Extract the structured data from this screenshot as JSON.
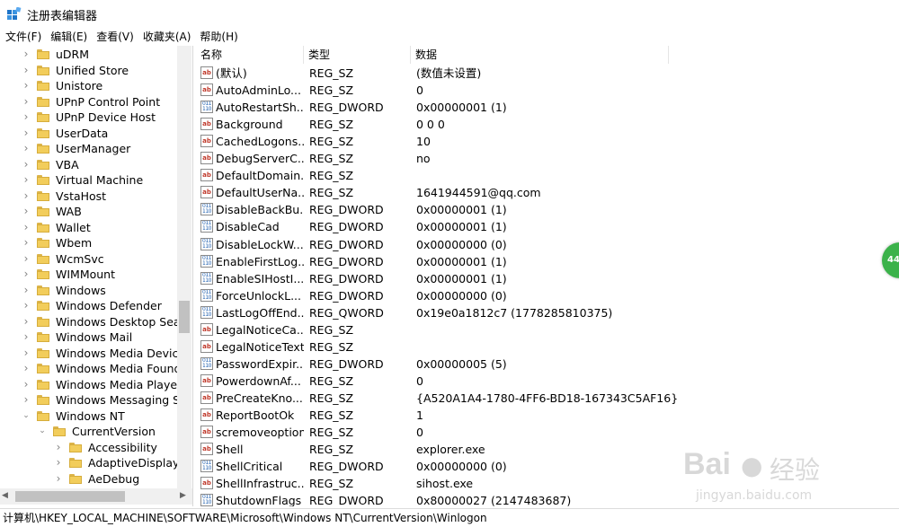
{
  "window": {
    "title": "注册表编辑器"
  },
  "menu": [
    "文件(F)",
    "编辑(E)",
    "查看(V)",
    "收藏夹(A)",
    "帮助(H)"
  ],
  "tree": {
    "items": [
      {
        "label": "uDRM",
        "depth": 0,
        "state": "collapsed"
      },
      {
        "label": "Unified Store",
        "depth": 0,
        "state": "collapsed"
      },
      {
        "label": "Unistore",
        "depth": 0,
        "state": "collapsed"
      },
      {
        "label": "UPnP Control Point",
        "depth": 0,
        "state": "collapsed"
      },
      {
        "label": "UPnP Device Host",
        "depth": 0,
        "state": "collapsed"
      },
      {
        "label": "UserData",
        "depth": 0,
        "state": "collapsed"
      },
      {
        "label": "UserManager",
        "depth": 0,
        "state": "collapsed"
      },
      {
        "label": "VBA",
        "depth": 0,
        "state": "collapsed"
      },
      {
        "label": "Virtual Machine",
        "depth": 0,
        "state": "collapsed"
      },
      {
        "label": "VstaHost",
        "depth": 0,
        "state": "collapsed"
      },
      {
        "label": "WAB",
        "depth": 0,
        "state": "collapsed"
      },
      {
        "label": "Wallet",
        "depth": 0,
        "state": "collapsed"
      },
      {
        "label": "Wbem",
        "depth": 0,
        "state": "collapsed"
      },
      {
        "label": "WcmSvc",
        "depth": 0,
        "state": "collapsed"
      },
      {
        "label": "WIMMount",
        "depth": 0,
        "state": "collapsed"
      },
      {
        "label": "Windows",
        "depth": 0,
        "state": "collapsed"
      },
      {
        "label": "Windows Defender",
        "depth": 0,
        "state": "collapsed"
      },
      {
        "label": "Windows Desktop Sear",
        "depth": 0,
        "state": "collapsed"
      },
      {
        "label": "Windows Mail",
        "depth": 0,
        "state": "collapsed"
      },
      {
        "label": "Windows Media Device",
        "depth": 0,
        "state": "collapsed"
      },
      {
        "label": "Windows Media Found",
        "depth": 0,
        "state": "collapsed"
      },
      {
        "label": "Windows Media Player",
        "depth": 0,
        "state": "collapsed"
      },
      {
        "label": "Windows Messaging Su",
        "depth": 0,
        "state": "collapsed"
      },
      {
        "label": "Windows NT",
        "depth": 0,
        "state": "expanded"
      },
      {
        "label": "CurrentVersion",
        "depth": 1,
        "state": "expanded"
      },
      {
        "label": "Accessibility",
        "depth": 2,
        "state": "collapsed"
      },
      {
        "label": "AdaptiveDisplayB",
        "depth": 2,
        "state": "collapsed"
      },
      {
        "label": "AeDebug",
        "depth": 2,
        "state": "collapsed"
      }
    ]
  },
  "list": {
    "headers": {
      "name": "名称",
      "type": "类型",
      "data": "数据"
    },
    "rows": [
      {
        "icon": "ab",
        "name": "(默认)",
        "type": "REG_SZ",
        "data": "(数值未设置)"
      },
      {
        "icon": "ab",
        "name": "AutoAdminLo...",
        "type": "REG_SZ",
        "data": "0"
      },
      {
        "icon": "bin",
        "name": "AutoRestartSh...",
        "type": "REG_DWORD",
        "data": "0x00000001 (1)"
      },
      {
        "icon": "ab",
        "name": "Background",
        "type": "REG_SZ",
        "data": "0 0 0"
      },
      {
        "icon": "ab",
        "name": "CachedLogons...",
        "type": "REG_SZ",
        "data": "10"
      },
      {
        "icon": "ab",
        "name": "DebugServerC...",
        "type": "REG_SZ",
        "data": "no"
      },
      {
        "icon": "ab",
        "name": "DefaultDomain...",
        "type": "REG_SZ",
        "data": ""
      },
      {
        "icon": "ab",
        "name": "DefaultUserNa...",
        "type": "REG_SZ",
        "data": "1641944591@qq.com"
      },
      {
        "icon": "bin",
        "name": "DisableBackBu...",
        "type": "REG_DWORD",
        "data": "0x00000001 (1)"
      },
      {
        "icon": "bin",
        "name": "DisableCad",
        "type": "REG_DWORD",
        "data": "0x00000001 (1)"
      },
      {
        "icon": "bin",
        "name": "DisableLockW...",
        "type": "REG_DWORD",
        "data": "0x00000000 (0)"
      },
      {
        "icon": "bin",
        "name": "EnableFirstLog...",
        "type": "REG_DWORD",
        "data": "0x00000001 (1)"
      },
      {
        "icon": "bin",
        "name": "EnableSIHostI...",
        "type": "REG_DWORD",
        "data": "0x00000001 (1)"
      },
      {
        "icon": "bin",
        "name": "ForceUnlockL...",
        "type": "REG_DWORD",
        "data": "0x00000000 (0)"
      },
      {
        "icon": "bin",
        "name": "LastLogOffEnd...",
        "type": "REG_QWORD",
        "data": "0x19e0a1812c7 (1778285810375)"
      },
      {
        "icon": "ab",
        "name": "LegalNoticeCa...",
        "type": "REG_SZ",
        "data": ""
      },
      {
        "icon": "ab",
        "name": "LegalNoticeText",
        "type": "REG_SZ",
        "data": ""
      },
      {
        "icon": "bin",
        "name": "PasswordExpir...",
        "type": "REG_DWORD",
        "data": "0x00000005 (5)"
      },
      {
        "icon": "ab",
        "name": "PowerdownAf...",
        "type": "REG_SZ",
        "data": "0"
      },
      {
        "icon": "ab",
        "name": "PreCreateKno...",
        "type": "REG_SZ",
        "data": "{A520A1A4-1780-4FF6-BD18-167343C5AF16}"
      },
      {
        "icon": "ab",
        "name": "ReportBootOk",
        "type": "REG_SZ",
        "data": "1"
      },
      {
        "icon": "ab",
        "name": "scremoveoption",
        "type": "REG_SZ",
        "data": "0"
      },
      {
        "icon": "ab",
        "name": "Shell",
        "type": "REG_SZ",
        "data": "explorer.exe"
      },
      {
        "icon": "bin",
        "name": "ShellCritical",
        "type": "REG_DWORD",
        "data": "0x00000000 (0)"
      },
      {
        "icon": "ab",
        "name": "ShellInfrastruc...",
        "type": "REG_SZ",
        "data": "sihost.exe"
      },
      {
        "icon": "bin",
        "name": "ShutdownFlags",
        "type": "REG_DWORD",
        "data": "0x80000027 (2147483687)"
      }
    ]
  },
  "statusbar": {
    "path": "计算机\\HKEY_LOCAL_MACHINE\\SOFTWARE\\Microsoft\\Windows NT\\CurrentVersion\\Winlogon"
  },
  "overlay": {
    "badge_text": "44",
    "watermark_brand": "Bai",
    "watermark_cn": "经验",
    "watermark_url": "jingyan.baidu.com"
  },
  "colors": {
    "folder": "#f2cd5b",
    "badge": "#3bb24a",
    "icon_ab": "#c0392b",
    "icon_bin": "#2060b0"
  }
}
